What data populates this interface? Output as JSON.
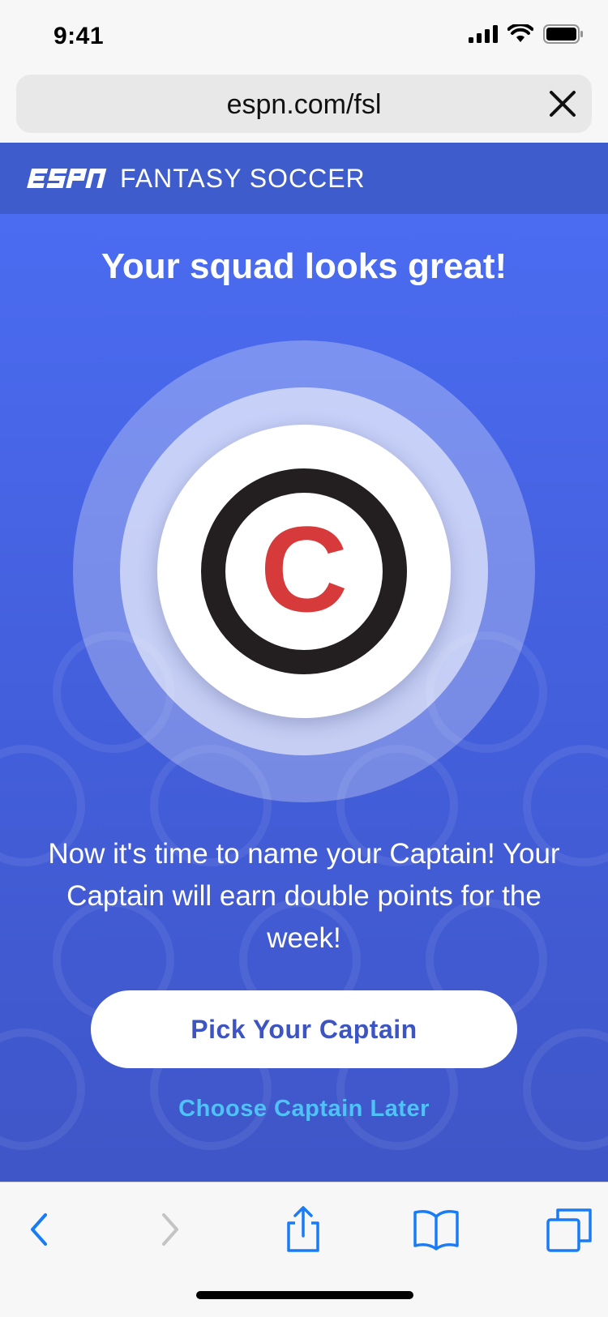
{
  "status_bar": {
    "time": "9:41"
  },
  "browser": {
    "url": "espn.com/fsl"
  },
  "header": {
    "logo_text": "ESPN",
    "title": "FANTASY SOCCER"
  },
  "main": {
    "headline": "Your squad looks great!",
    "badge_letter": "C",
    "body_text": "Now it's time to name your Captain! Your Captain will earn double points for the week!",
    "primary_button": "Pick Your Captain",
    "secondary_link": "Choose Captain Later"
  },
  "colors": {
    "brand_blue": "#3e5ccc",
    "badge_red": "#d63a3a",
    "link_cyan": "#4fc3f7",
    "ios_blue": "#1a7cf5"
  },
  "toolbar": {
    "icons": [
      "chevron-left-icon",
      "chevron-right-icon",
      "share-icon",
      "bookmarks-icon",
      "tabs-icon"
    ]
  }
}
